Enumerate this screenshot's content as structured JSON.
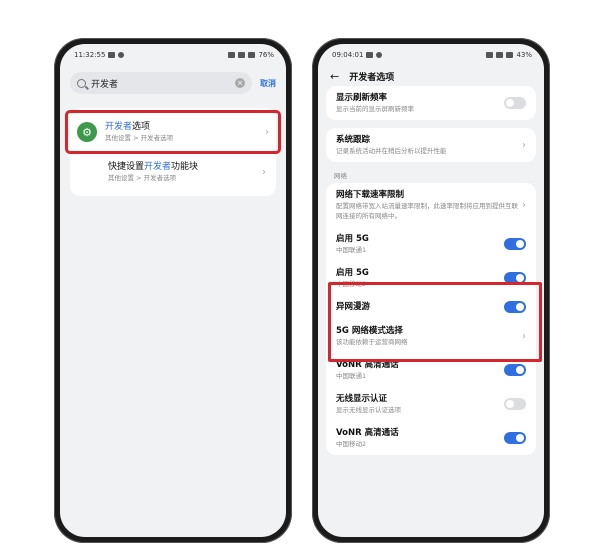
{
  "left_phone": {
    "status": {
      "time": "11:32:55",
      "battery": "76%"
    },
    "search": {
      "value": "开发者",
      "cancel_label": "取消"
    },
    "results": [
      {
        "title_highlight": "开发者",
        "title_rest": "选项",
        "subtitle": "其他设置 > 开发者选项",
        "icon": "gear-icon"
      },
      {
        "title_prefix": "快捷设置",
        "title_highlight": "开发者",
        "title_rest": "功能块",
        "subtitle": "其他设置 > 开发者选项"
      }
    ]
  },
  "right_phone": {
    "status": {
      "time": "09:04:01",
      "battery": "43%"
    },
    "nav": {
      "title": "开发者选项"
    },
    "rows": {
      "refresh_rate": {
        "title": "显示刷新频率",
        "subtitle": "显示当前的显示屏刷新频率",
        "on": false
      },
      "system_trace": {
        "title": "系统跟踪",
        "subtitle": "记录系统活动并在稍后分析以提升性能"
      },
      "section_network": "网络",
      "download_limit": {
        "title": "网络下载速率限制",
        "subtitle": "配置网络带宽入站流量速率限制，此速率限制将应用到提供互联网连接的所有网络中。"
      },
      "sim1_5g": {
        "title": "启用 5G",
        "subtitle": "中国联通1",
        "on": true
      },
      "sim2_5g": {
        "title": "启用 5G",
        "subtitle": "中国移动2",
        "on": true
      },
      "roaming": {
        "title": "异网漫游",
        "on": true
      },
      "nr_mode": {
        "title": "5G 网络模式选择",
        "subtitle": "该功能依赖于运营商网络"
      },
      "vonr1": {
        "title": "VoNR 高清通话",
        "subtitle": "中国联通1",
        "on": true
      },
      "wireless_display": {
        "title": "无线显示认证",
        "subtitle": "显示无线显示认证选项",
        "on": false
      },
      "vonr2": {
        "title": "VoNR 高清通话",
        "subtitle": "中国移动2",
        "on": true
      }
    }
  },
  "colors": {
    "accent": "#2f6fe0",
    "highlight_box": "#d4262c",
    "icon_green": "#3e9a4b"
  }
}
